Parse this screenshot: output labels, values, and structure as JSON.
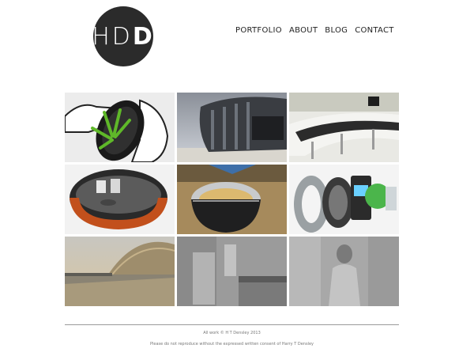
{
  "logo": {
    "text_light": "HD",
    "text_bold": "D"
  },
  "nav": [
    {
      "label": "PORTFOLIO"
    },
    {
      "label": "ABOUT"
    },
    {
      "label": "BLOG"
    },
    {
      "label": "CONTACT"
    }
  ],
  "footer": {
    "copyright": "All work © H T Densley 2013",
    "notice": "Please do not reproduce without the expressed written consent of Harry T Densley"
  }
}
